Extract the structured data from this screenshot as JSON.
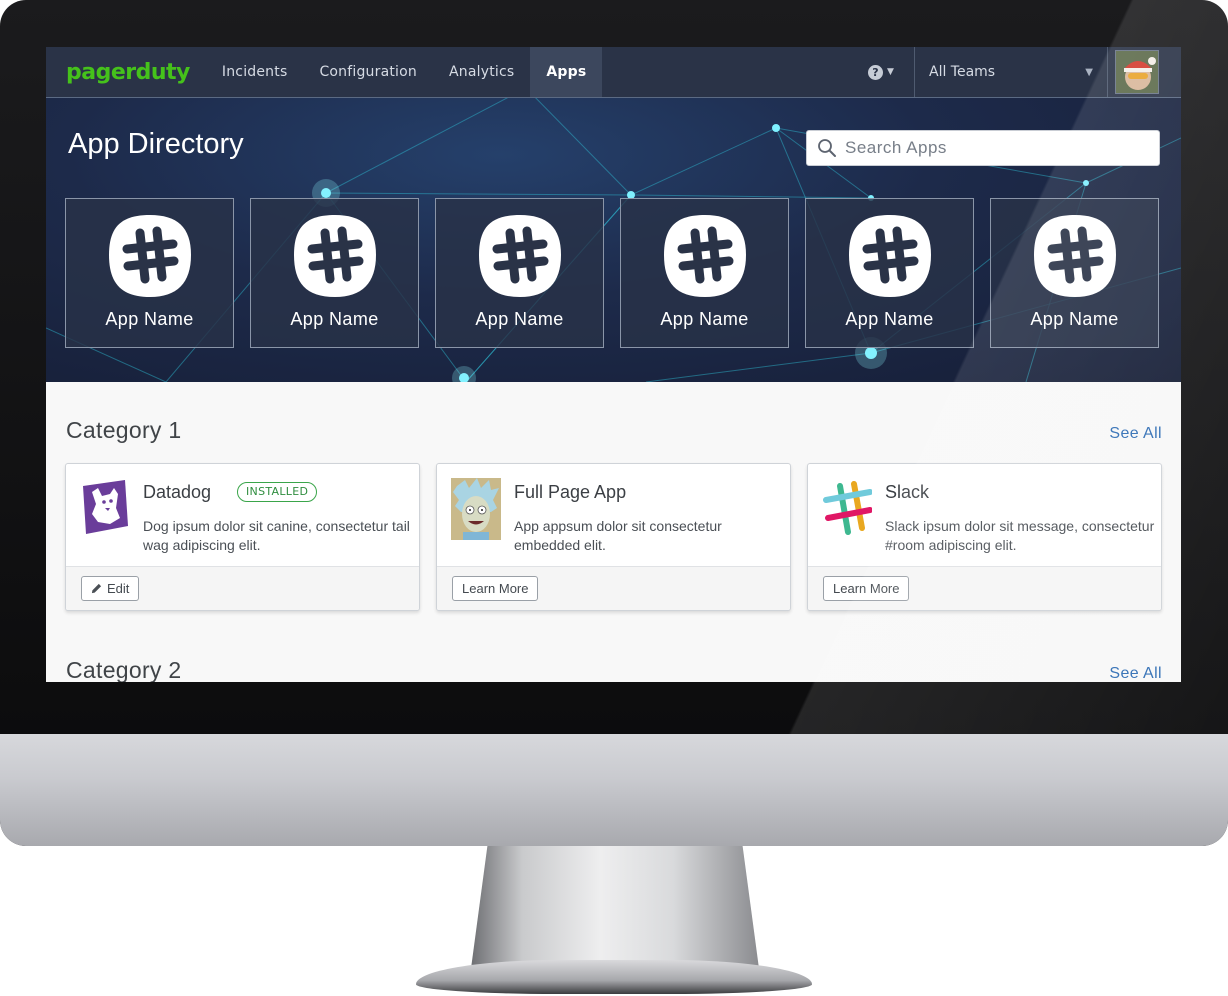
{
  "nav": {
    "logo": "pagerduty",
    "items": [
      {
        "label": "Incidents"
      },
      {
        "label": "Configuration"
      },
      {
        "label": "Analytics"
      },
      {
        "label": "Apps"
      }
    ],
    "active": "Apps",
    "help_icon": "question-circle-icon",
    "teams_label": "All Teams"
  },
  "hero": {
    "title": "App Directory",
    "search_placeholder": "Search Apps",
    "tiles": [
      {
        "name": "App Name",
        "icon": "slack-hash-icon"
      },
      {
        "name": "App Name",
        "icon": "slack-hash-icon"
      },
      {
        "name": "App Name",
        "icon": "slack-hash-icon"
      },
      {
        "name": "App Name",
        "icon": "slack-hash-icon"
      },
      {
        "name": "App Name",
        "icon": "slack-hash-icon"
      },
      {
        "name": "App Name",
        "icon": "slack-hash-icon"
      }
    ]
  },
  "categories": [
    {
      "title": "Category 1",
      "see_all": "See All",
      "apps": [
        {
          "name": "Datadog",
          "badge": "INSTALLED",
          "description": "Dog ipsum dolor sit canine, consectetur tail wag adipiscing elit.",
          "button": "Edit",
          "icon": "datadog-logo"
        },
        {
          "name": "Full Page App",
          "description": "App appsum dolor sit consectetur embedded elit.",
          "button": "Learn More",
          "icon": "rick-avatar"
        },
        {
          "name": "Slack",
          "description": "Slack ipsum dolor sit message, consectetur #room adipiscing elit.",
          "button": "Learn More",
          "icon": "slack-logo"
        }
      ]
    },
    {
      "title": "Category 2",
      "see_all": "See All"
    }
  ],
  "colors": {
    "nav_bg": "#2a3347",
    "logo_green": "#45c21b",
    "link_blue": "#2f6db4",
    "installed_green": "#3aa54a"
  }
}
